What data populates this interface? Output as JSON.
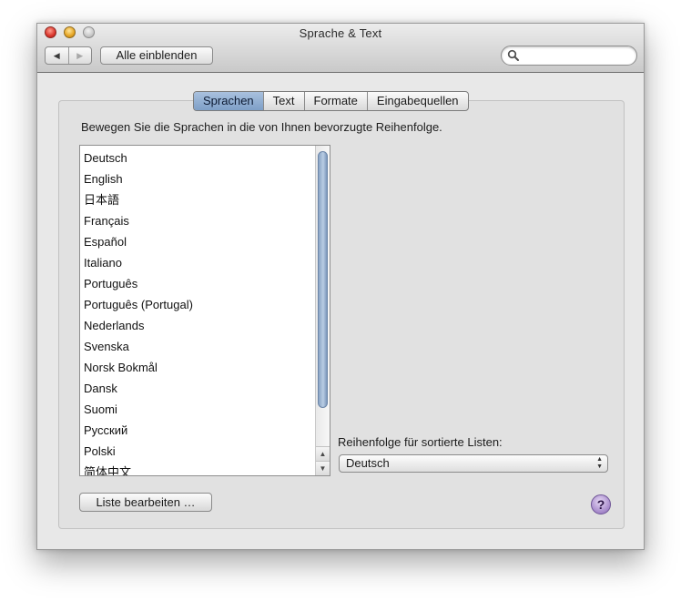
{
  "window": {
    "title": "Sprache & Text",
    "show_all_label": "Alle einblenden",
    "back_glyph": "◀",
    "forward_glyph": "▶",
    "search_placeholder": ""
  },
  "tabs": [
    {
      "label": "Sprachen",
      "selected": true
    },
    {
      "label": "Text",
      "selected": false
    },
    {
      "label": "Formate",
      "selected": false
    },
    {
      "label": "Eingabequellen",
      "selected": false
    }
  ],
  "instruction": "Bewegen Sie die Sprachen in die von Ihnen bevorzugte Reihenfolge.",
  "languages": [
    "Deutsch",
    "English",
    "日本語",
    "Français",
    "Español",
    "Italiano",
    "Português",
    "Português (Portugal)",
    "Nederlands",
    "Svenska",
    "Norsk Bokmål",
    "Dansk",
    "Suomi",
    "Русский",
    "Polski",
    "简体中文"
  ],
  "sort_order": {
    "label": "Reihenfolge für sortierte Listen:",
    "value": "Deutsch"
  },
  "edit_list_label": "Liste bearbeiten …",
  "help_label": "?",
  "colors": {
    "selected_tab": "#7e9fc7",
    "scroll_thumb": "#8aa4c4",
    "help_button": "#a487c9"
  }
}
